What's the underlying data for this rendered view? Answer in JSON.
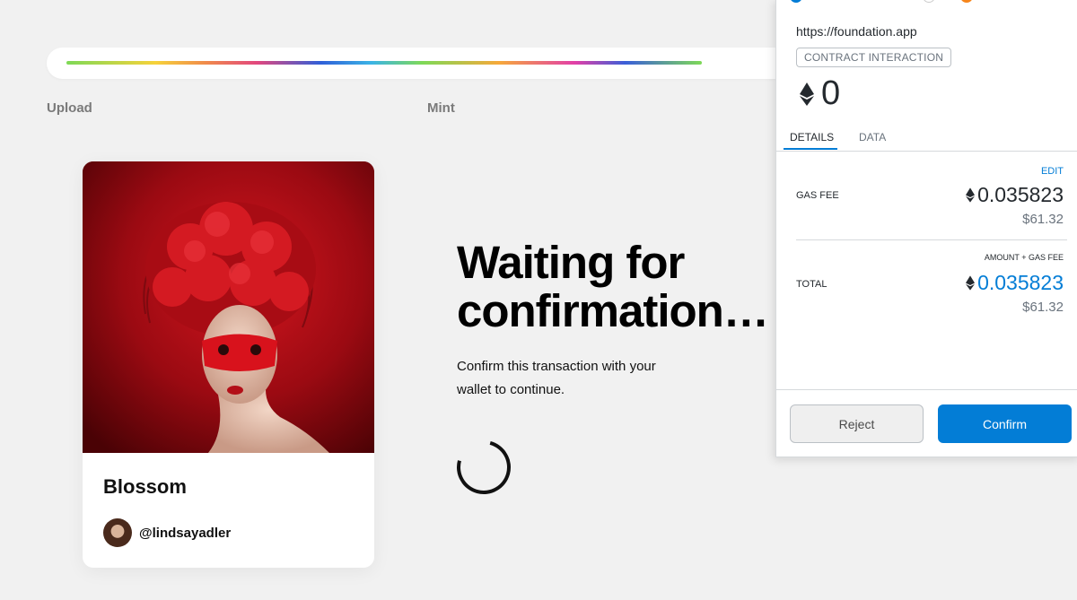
{
  "steps": {
    "upload": "Upload",
    "mint": "Mint"
  },
  "progress": {
    "value": 0.89
  },
  "card": {
    "title": "Blossom",
    "creator": "@lindsayadler"
  },
  "waiting": {
    "title": "Waiting for confirmation…",
    "message": "Confirm this transaction with your wallet to continue."
  },
  "wallet": {
    "origin": "https://foundation.app",
    "badge": "CONTRACT INTERACTION",
    "amount": "0",
    "tabs": {
      "details": "DETAILS",
      "data": "DATA"
    },
    "edit": "EDIT",
    "gas_label": "GAS FEE",
    "gas_value": "0.035823",
    "gas_usd": "$61.32",
    "amount_gas_label": "AMOUNT + GAS FEE",
    "total_label": "TOTAL",
    "total_value": "0.035823",
    "total_usd": "$61.32",
    "reject": "Reject",
    "confirm": "Confirm"
  },
  "colors": {
    "accent": "#037dd6",
    "artwork": "#b30f18"
  },
  "icons": {
    "eth": "eth-icon",
    "spinner": "loading-spinner-icon"
  }
}
